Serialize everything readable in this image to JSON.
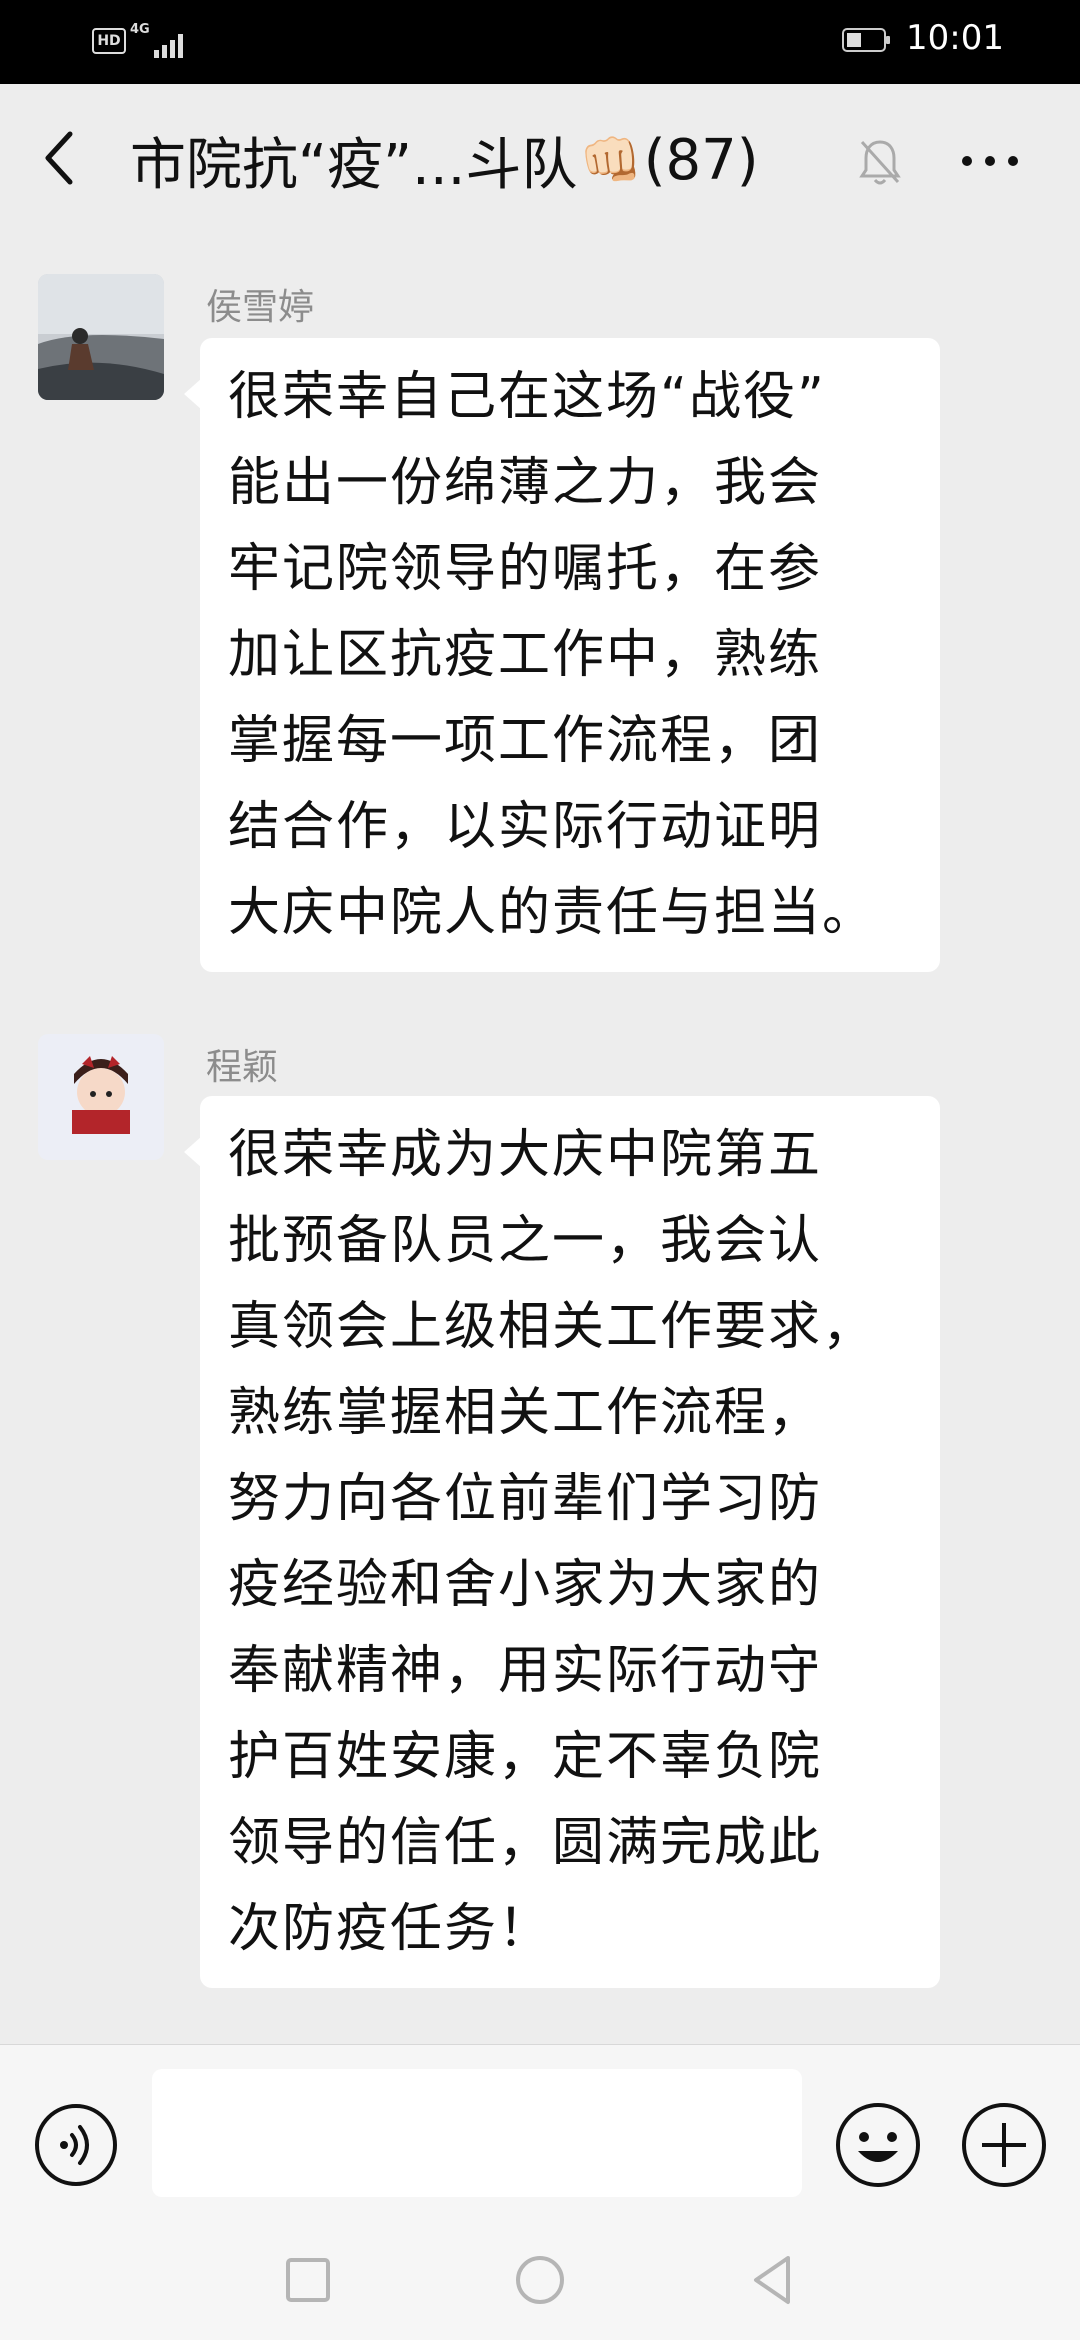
{
  "status_bar": {
    "hd_label": "HD",
    "network": "4G",
    "time": "10:01"
  },
  "header": {
    "title_prefix": "市院抗“疫”...斗队",
    "title_emoji": "👊🏻",
    "member_count": "(87)"
  },
  "messages": [
    {
      "sender": "侯雪婷",
      "lines": [
        "很荣幸自己在这场“战役”",
        "能出一份绵薄之力，我会",
        "牢记院领导的嘱托，在参",
        "加让区抗疫工作中，熟练",
        "掌握每一项工作流程，团",
        "结合作，以实际行动证明",
        "大庆中院人的责任与担当。"
      ]
    },
    {
      "sender": "程颖",
      "lines": [
        "很荣幸成为大庆中院第五",
        "批预备队员之一，我会认",
        "真领会上级相关工作要求，",
        "熟练掌握相关工作流程，",
        "努力向各位前辈们学习防",
        "疫经验和舍小家为大家的",
        "奉献精神，用实际行动守",
        "护百姓安康，定不辜负院",
        "领导的信任，圆满完成此",
        "次防疫任务！"
      ]
    }
  ],
  "input_bar": {
    "placeholder": ""
  },
  "icons": {
    "back": "chevron-left-icon",
    "mute": "bell-off-icon",
    "more": "more-horizontal-icon",
    "voice": "voice-icon",
    "emoji": "smiley-icon",
    "add": "plus-circle-icon"
  }
}
